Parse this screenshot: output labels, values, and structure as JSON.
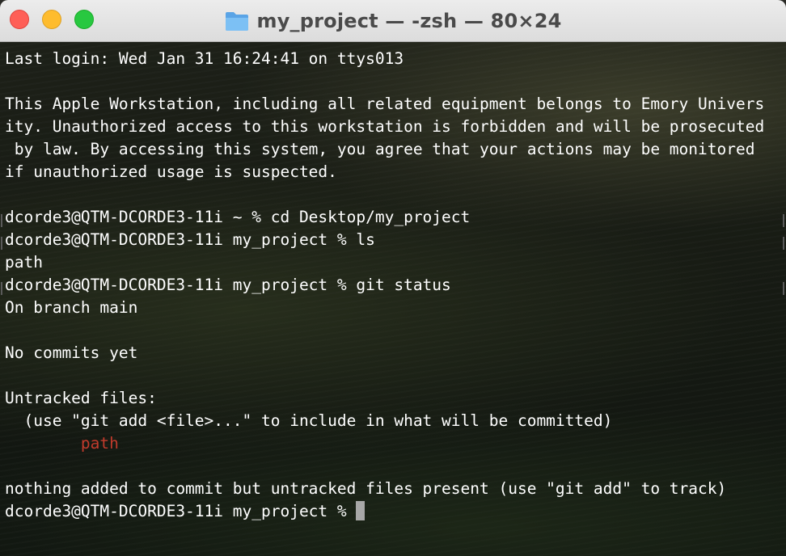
{
  "window": {
    "title": "my_project — -zsh — 80×24"
  },
  "terminal": {
    "lines": [
      {
        "text": "Last login: Wed Jan 31 16:24:41 on ttys013"
      },
      {
        "text": ""
      },
      {
        "text": "This Apple Workstation, including all related equipment belongs to Emory Univers"
      },
      {
        "text": "ity. Unauthorized access to this workstation is forbidden and will be prosecuted"
      },
      {
        "text": " by law. By accessing this system, you agree that your actions may be monitored"
      },
      {
        "text": "if unauthorized usage is suspected."
      },
      {
        "text": ""
      },
      {
        "text": "dcorde3@QTM-DCORDE3-11i ~ % cd Desktop/my_project"
      },
      {
        "text": "dcorde3@QTM-DCORDE3-11i my_project % ls"
      },
      {
        "text": "path"
      },
      {
        "text": "dcorde3@QTM-DCORDE3-11i my_project % git status"
      },
      {
        "text": "On branch main"
      },
      {
        "text": ""
      },
      {
        "text": "No commits yet"
      },
      {
        "text": ""
      },
      {
        "text": "Untracked files:"
      },
      {
        "text": "  (use \"git add <file>...\" to include in what will be committed)"
      },
      {
        "text": "\tpath"
      },
      {
        "text": ""
      },
      {
        "text": "nothing added to commit but untracked files present (use \"git add\" to track)"
      },
      {
        "text": "dcorde3@QTM-DCORDE3-11i my_project % "
      }
    ]
  },
  "colors": {
    "untracked_file": "#c23b2c",
    "text": "#ffffff",
    "cursor": "#a7a7a7"
  },
  "icons": {
    "title_icon": "folder-icon"
  }
}
